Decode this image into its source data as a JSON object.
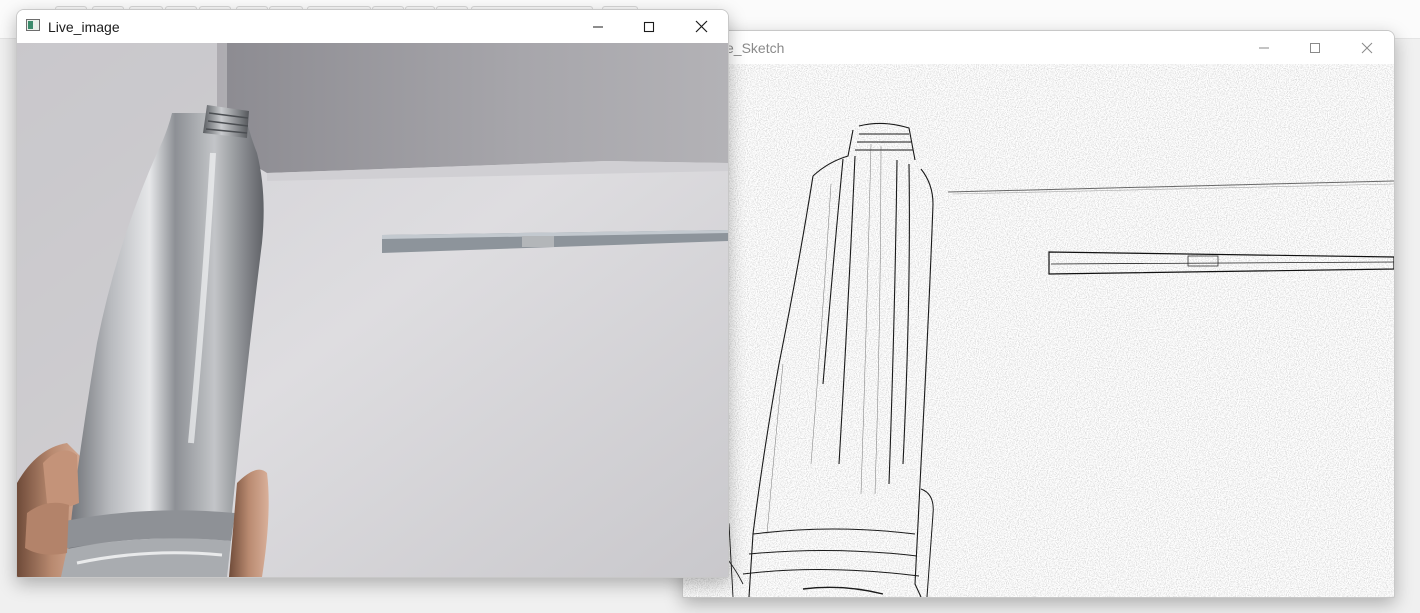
{
  "windows": {
    "live": {
      "title": "Live_image",
      "buttons": [
        "minimize",
        "maximize",
        "close"
      ]
    },
    "sketch": {
      "title": "e_Sketch",
      "buttons": [
        "minimize",
        "maximize",
        "close"
      ]
    }
  },
  "colors": {
    "wall": "#d9d8dc",
    "ceiling": "#9c9ba1",
    "bottle": "#b9bbbf",
    "skin": "#c79a80",
    "titlebar": "#ffffff",
    "sketch_line": "#1a1a1a"
  },
  "icons": {
    "app": "opencv-window-icon",
    "minimize": "minimize-icon",
    "maximize": "maximize-icon",
    "close": "close-icon"
  }
}
